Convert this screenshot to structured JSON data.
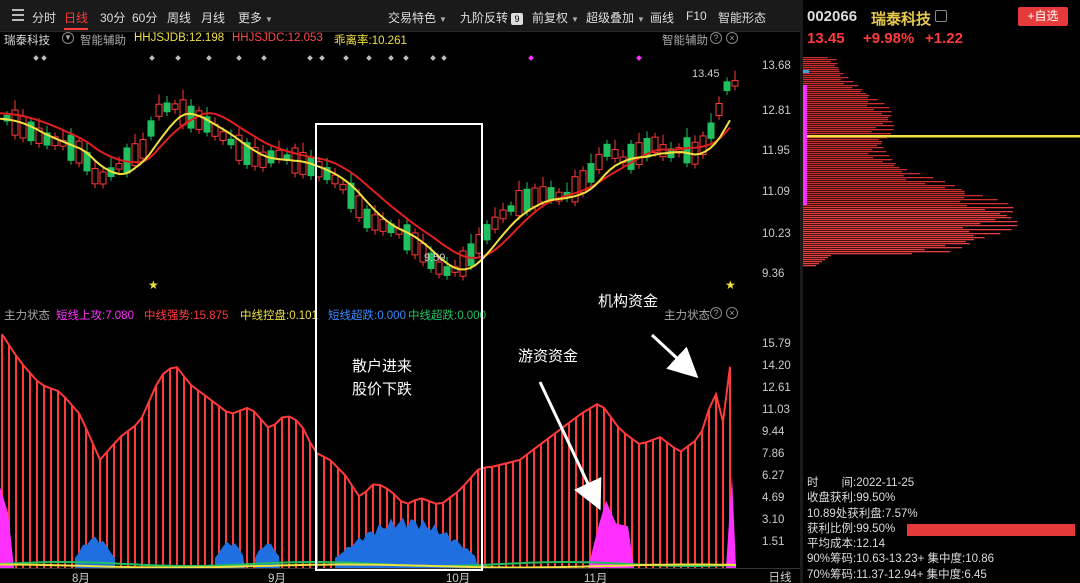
{
  "toolbar": {
    "items": [
      "分时",
      "日线",
      "30分",
      "60分",
      "周线",
      "月线",
      "更多"
    ],
    "active": "日线",
    "right_items": [
      "交易特色",
      "九阶反转",
      "前复权",
      "超级叠加",
      "画线",
      "F10",
      "智能形态"
    ],
    "nine_badge": "9"
  },
  "kline_header": {
    "name": "瑞泰科技",
    "assist": "智能辅助",
    "jdb": "HHJSJDB:12.198",
    "jdc": "HHJSJDC:12.053",
    "lilv": "乖离率:10.261",
    "right_assist": "智能辅助"
  },
  "price_axis": [
    "13.68",
    "12.81",
    "11.95",
    "11.09",
    "10.23",
    "9.36"
  ],
  "price_marks": {
    "high": "13.45",
    "low": "9.59"
  },
  "indicator_header": {
    "title": "主力状态",
    "s1": "短线上攻:7.080",
    "s2": "中线强势:15.875",
    "s3": "中线控盘:0.101",
    "s4": "短线超跌:0.000",
    "s5": "中线超跌:0.000",
    "right_title": "主力状态"
  },
  "indicator_axis": [
    "15.79",
    "14.20",
    "12.61",
    "11.03",
    "9.44",
    "7.86",
    "6.27",
    "4.69",
    "3.10",
    "1.51"
  ],
  "x_axis": [
    "8月",
    "9月",
    "10月",
    "11月"
  ],
  "period": "日线",
  "annotations": {
    "box_text_1": "散户进来",
    "box_text_2": "股价下跌",
    "hot_money": "游资资金",
    "institution": "机构资金"
  },
  "stock": {
    "code": "002066",
    "name": "瑞泰科技",
    "price": "13.45",
    "change_pct": "+9.98%",
    "change": "+1.22",
    "add_watch": "+自选"
  },
  "chip_stats": {
    "time": "时　　间:2022-11-25",
    "profit_ratio": "收盘获利:99.50%",
    "at_price": "10.89处获利盘:7.57%",
    "win_ratio": "获利比例:99.50%",
    "avg_cost": "平均成本:12.14",
    "chip90": "90%筹码:10.63-13.23+ 集中度:10.86",
    "chip70": "70%筹码:11.37-12.94+ 集中度:6.45"
  },
  "colors": {
    "up": "#ff3a3a",
    "down": "#20c060",
    "ma_fast": "#f0e040",
    "ma_slow": "#e02020",
    "blue": "#1f6fe0",
    "magenta": "#ff30ff"
  }
}
